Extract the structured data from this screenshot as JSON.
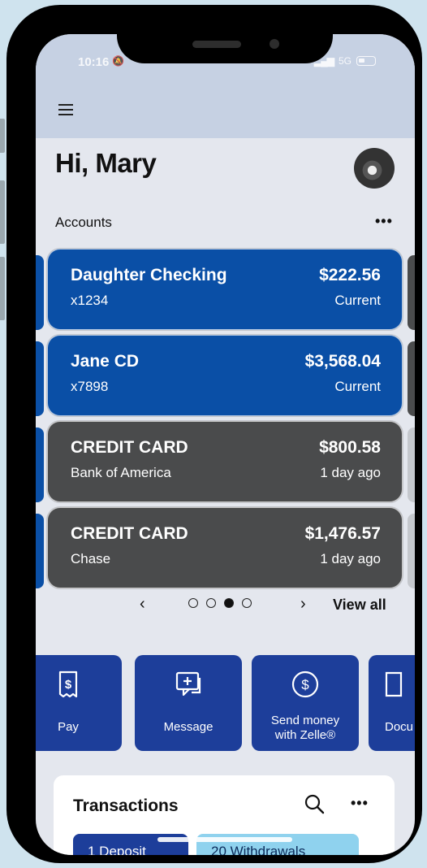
{
  "status": {
    "time": "10:16",
    "network": "5G"
  },
  "header": {
    "greeting": "Hi, Mary"
  },
  "accounts": {
    "label": "Accounts",
    "more": "•••",
    "cards": [
      {
        "name": "Daughter Checking",
        "sub": "x1234",
        "amount": "$222.56",
        "meta": "Current",
        "color": "#0a4fa6"
      },
      {
        "name": "Jane CD",
        "sub": "x7898",
        "amount": "$3,568.04",
        "meta": "Current",
        "color": "#0a4fa6"
      },
      {
        "name": "CREDIT CARD",
        "sub": "Bank of America",
        "amount": "$800.58",
        "meta": "1 day ago",
        "color": "#4a4b4c"
      },
      {
        "name": "CREDIT CARD",
        "sub": "Chase",
        "amount": "$1,476.57",
        "meta": "1 day ago",
        "color": "#4a4b4c"
      }
    ]
  },
  "pager": {
    "prev": "‹",
    "next": "›",
    "view_all": "View all",
    "page_count": 4,
    "current_page": 3
  },
  "actions": {
    "pay": "Pay",
    "message": "Message",
    "zelle_line1": "Send money",
    "zelle_line2": "with Zelle®",
    "documents": "Docu"
  },
  "transactions": {
    "title": "Transactions",
    "more": "•••",
    "deposit_chip": "1 Deposit",
    "withdrawals_chip": "20 Withdrawals"
  },
  "colors": {
    "brand_blue": "#0a4fa6",
    "action_blue": "#1d3e9a",
    "card_gray": "#4a4b4c",
    "chip_light": "#8fd2ee"
  }
}
